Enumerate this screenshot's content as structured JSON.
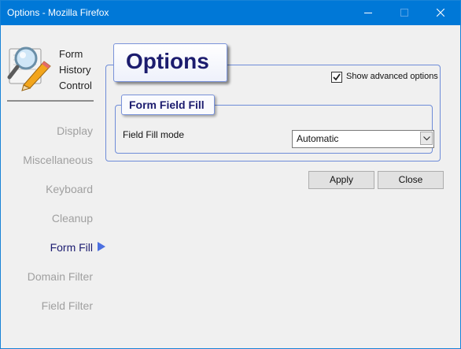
{
  "window": {
    "title": "Options - Mozilla Firefox"
  },
  "sidebar": {
    "logo_lines": [
      "Form",
      "History",
      "Control"
    ],
    "items": [
      {
        "label": "Display",
        "active": false
      },
      {
        "label": "Miscellaneous",
        "active": false
      },
      {
        "label": "Keyboard",
        "active": false
      },
      {
        "label": "Cleanup",
        "active": false
      },
      {
        "label": "Form Fill",
        "active": true
      },
      {
        "label": "Domain Filter",
        "active": false
      },
      {
        "label": "Field Filter",
        "active": false
      }
    ]
  },
  "main": {
    "title": "Options",
    "advanced_checkbox": {
      "label": "Show advanced options",
      "checked": true
    },
    "section": {
      "title": "Form Field Fill",
      "field_label": "Field Fill mode",
      "select_value": "Automatic"
    }
  },
  "buttons": {
    "apply": "Apply",
    "close": "Close"
  },
  "colors": {
    "titlebar": "#0078d7",
    "accent_border": "#6e8cd8",
    "heading_text": "#1c1c6e",
    "nav_inactive": "#a0a0a0",
    "nav_active": "#1c1c70",
    "nav_arrow": "#4c70e0"
  }
}
